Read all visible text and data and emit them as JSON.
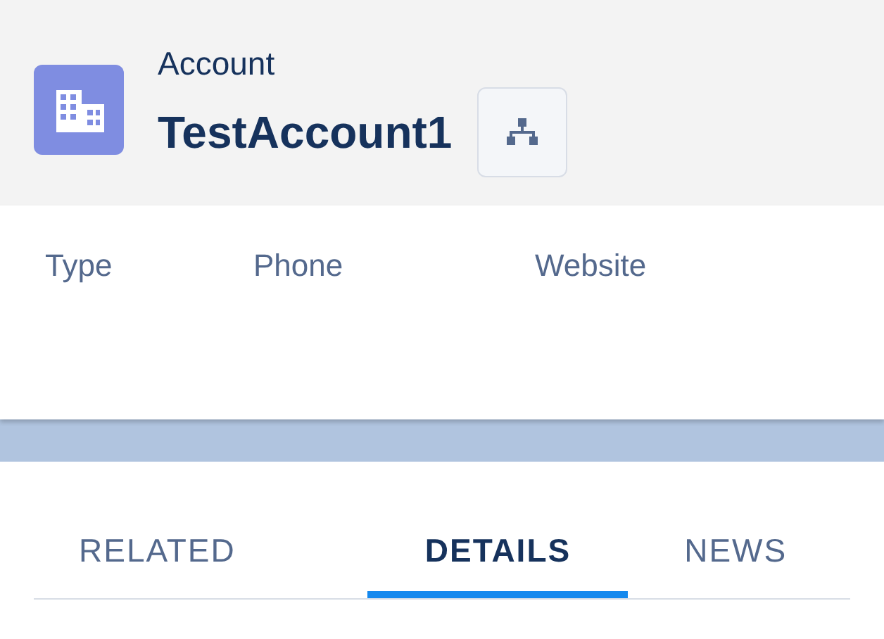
{
  "header": {
    "object_type": "Account",
    "title": "TestAccount1"
  },
  "fields": [
    {
      "label": "Type"
    },
    {
      "label": "Phone"
    },
    {
      "label": "Website"
    }
  ],
  "tabs": [
    {
      "label": "RELATED",
      "selected": false
    },
    {
      "label": "DETAILS",
      "selected": true
    },
    {
      "label": "NEWS",
      "selected": false
    }
  ]
}
